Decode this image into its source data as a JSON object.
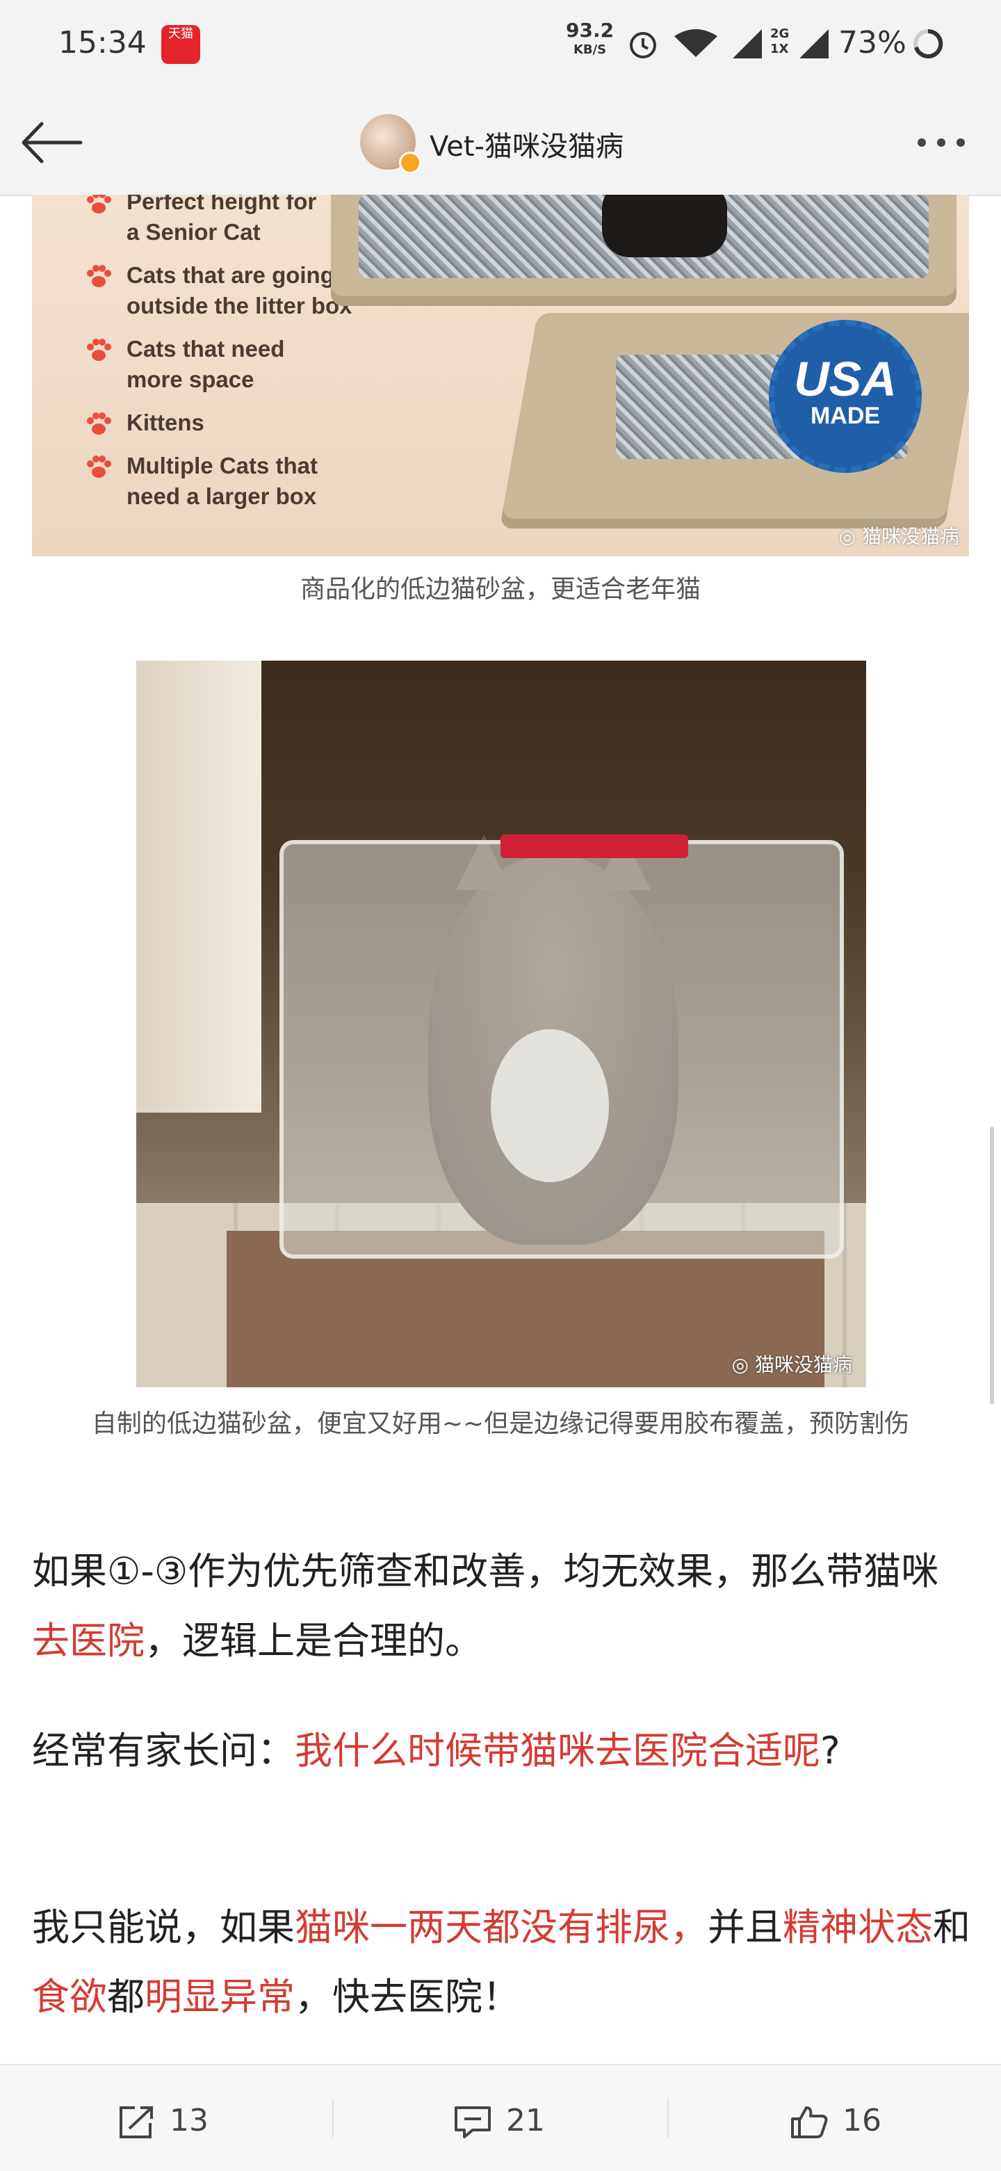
{
  "status_bar": {
    "time": "15:34",
    "app_icon_text": "天猫",
    "net_speed_value": "93.2",
    "net_speed_unit": "KB/S",
    "signal_label": "2G 1X",
    "battery": "73%"
  },
  "header": {
    "title": "Vet-猫咪没猫病"
  },
  "image1": {
    "bullets": [
      "Perfect height for a Senior Cat",
      "Cats that are going outside the litter box",
      "Cats that need more space",
      "Kittens",
      "Multiple Cats that need a larger box"
    ],
    "badge_line1": "USA",
    "badge_line2": "MADE",
    "watermark": "猫咪没猫病"
  },
  "caption1": "商品化的低边猫砂盆，更适合老年猫",
  "image2": {
    "watermark": "猫咪没猫病"
  },
  "caption2": "自制的低边猫砂盆，便宜又好用~~但是边缘记得要用胶布覆盖，预防割伤",
  "paragraphs": {
    "p1_a": "如果①-③作为优先筛查和改善，均无效果，那么带猫咪",
    "p1_red": "去医院",
    "p1_b": "，逻辑上是合理的。",
    "p2_a": "经常有家长问：",
    "p2_red": "我什么时候带猫咪去医院合适呢",
    "p2_b": "?",
    "p3_a": "我只能说，如果",
    "p3_red1": "猫咪一两天都没有排尿，",
    "p3_b": "并且",
    "p3_red2": "精神状态",
    "p3_c": "和",
    "p3_red3": "食欲",
    "p3_d": "都",
    "p3_red4": "明显异常",
    "p3_e": "，快去医院！"
  },
  "bottom_bar": {
    "share_count": "13",
    "comment_count": "21",
    "like_count": "16"
  },
  "colors": {
    "accent_red": "#d43b33",
    "badge_blue": "#1f5fa8"
  }
}
